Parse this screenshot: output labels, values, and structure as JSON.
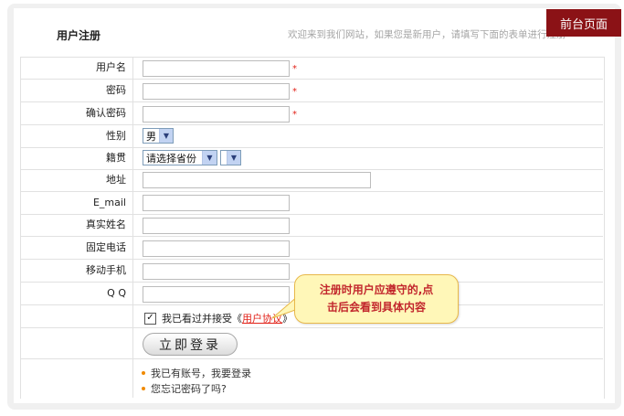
{
  "page": {
    "title": "用户注册",
    "welcome": "欢迎来到我们网站，如果您是新用户，请填写下面的表单进行注册",
    "front_button": "前台页面"
  },
  "fields": {
    "username": {
      "label": "用户名",
      "value": "",
      "required": "*"
    },
    "password": {
      "label": "密码",
      "value": "",
      "required": "*"
    },
    "confirm_password": {
      "label": "确认密码",
      "value": "",
      "required": "*"
    },
    "gender": {
      "label": "性别",
      "selected": "男"
    },
    "native_place": {
      "label": "籍贯",
      "province": "请选择省份",
      "city": ""
    },
    "address": {
      "label": "地址",
      "value": ""
    },
    "email": {
      "label": "E_mail",
      "value": ""
    },
    "real_name": {
      "label": "真实姓名",
      "value": ""
    },
    "landline": {
      "label": "固定电话",
      "value": ""
    },
    "mobile": {
      "label": "移动手机",
      "value": ""
    },
    "qq": {
      "label": "Q Q",
      "value": ""
    }
  },
  "agreement": {
    "checked": true,
    "text_before": "我已看过并接受《",
    "link": "用户协议",
    "text_after": "》"
  },
  "submit_label": "立即登录",
  "links": {
    "has_account": "我已有账号，我要登录",
    "forgot": "您忘记密码了吗?"
  },
  "tooltip": {
    "line1": "注册时用户应遵守的,点",
    "line2": "击后会看到具体内容"
  },
  "colors": {
    "accent": "#8b1216",
    "required": "#e2231a",
    "tooltip_bg": "#fff7b8",
    "tooltip_text": "#c2272d",
    "bullet": "#f08a00"
  }
}
